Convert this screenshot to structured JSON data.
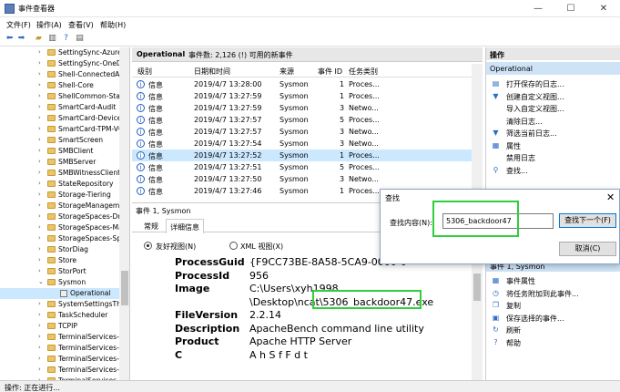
{
  "window": {
    "title": "事件查看器",
    "minimize": "—",
    "maximize": "☐",
    "close": "✕"
  },
  "menu": [
    "文件(F)",
    "操作(A)",
    "查看(V)",
    "帮助(H)"
  ],
  "tree": {
    "items": [
      {
        "label": "SettingSync-Azure",
        "type": "folder"
      },
      {
        "label": "SettingSync-OneDr",
        "type": "folder"
      },
      {
        "label": "Shell-ConnectedAc",
        "type": "folder"
      },
      {
        "label": "Shell-Core",
        "type": "folder"
      },
      {
        "label": "ShellCommon-Stan",
        "type": "folder"
      },
      {
        "label": "SmartCard-Audit",
        "type": "folder"
      },
      {
        "label": "SmartCard-DeviceE",
        "type": "folder"
      },
      {
        "label": "SmartCard-TPM-VC",
        "type": "folder"
      },
      {
        "label": "SmartScreen",
        "type": "folder"
      },
      {
        "label": "SMBClient",
        "type": "folder"
      },
      {
        "label": "SMBServer",
        "type": "folder"
      },
      {
        "label": "SMBWitnessClient",
        "type": "folder"
      },
      {
        "label": "StateRepository",
        "type": "folder"
      },
      {
        "label": "Storage-Tiering",
        "type": "folder"
      },
      {
        "label": "StorageManagemer",
        "type": "folder"
      },
      {
        "label": "StorageSpaces-Driv",
        "type": "folder"
      },
      {
        "label": "StorageSpaces-Mar",
        "type": "folder"
      },
      {
        "label": "StorageSpaces-Spa",
        "type": "folder"
      },
      {
        "label": "StorDiag",
        "type": "folder"
      },
      {
        "label": "Store",
        "type": "folder"
      },
      {
        "label": "StorPort",
        "type": "folder"
      },
      {
        "label": "Sysmon",
        "type": "folder-open"
      },
      {
        "label": "Operational",
        "type": "log"
      },
      {
        "label": "SystemSettingsThre",
        "type": "folder"
      },
      {
        "label": "TaskScheduler",
        "type": "folder"
      },
      {
        "label": "TCPIP",
        "type": "folder"
      },
      {
        "label": "TerminalServices-C",
        "type": "folder"
      },
      {
        "label": "TerminalServices-C",
        "type": "folder"
      },
      {
        "label": "TerminalServices-L",
        "type": "folder"
      },
      {
        "label": "TerminalServices-P",
        "type": "folder"
      },
      {
        "label": "TerminalServices-P",
        "type": "folder"
      }
    ],
    "expand_symbol": "›",
    "collapse_symbol": "⌄"
  },
  "events_panel": {
    "log_name": "Operational",
    "count_text": "事件数: 2,126 (!) 可用的新事件",
    "columns": [
      "级别",
      "日期和时间",
      "来源",
      "事件 ID",
      "任务类别"
    ],
    "rows": [
      {
        "level": "信息",
        "datetime": "2019/4/7 13:28:00",
        "source": "Sysmon",
        "event_id": "1",
        "category": "Proces..."
      },
      {
        "level": "信息",
        "datetime": "2019/4/7 13:27:59",
        "source": "Sysmon",
        "event_id": "1",
        "category": "Proces..."
      },
      {
        "level": "信息",
        "datetime": "2019/4/7 13:27:59",
        "source": "Sysmon",
        "event_id": "3",
        "category": "Netwo..."
      },
      {
        "level": "信息",
        "datetime": "2019/4/7 13:27:57",
        "source": "Sysmon",
        "event_id": "5",
        "category": "Proces..."
      },
      {
        "level": "信息",
        "datetime": "2019/4/7 13:27:57",
        "source": "Sysmon",
        "event_id": "3",
        "category": "Netwo..."
      },
      {
        "level": "信息",
        "datetime": "2019/4/7 13:27:54",
        "source": "Sysmon",
        "event_id": "3",
        "category": "Netwo..."
      },
      {
        "level": "信息",
        "datetime": "2019/4/7 13:27:52",
        "source": "Sysmon",
        "event_id": "1",
        "category": "Proces..."
      },
      {
        "level": "信息",
        "datetime": "2019/4/7 13:27:51",
        "source": "Sysmon",
        "event_id": "5",
        "category": "Proces..."
      },
      {
        "level": "信息",
        "datetime": "2019/4/7 13:27:50",
        "source": "Sysmon",
        "event_id": "3",
        "category": "Netwo..."
      },
      {
        "level": "信息",
        "datetime": "2019/4/7 13:27:46",
        "source": "Sysmon",
        "event_id": "1",
        "category": "Proces..."
      }
    ],
    "selected_index": 6,
    "info_glyph": "i"
  },
  "details": {
    "header": "事件 1, Sysmon",
    "close": "✕",
    "tabs": [
      "常规",
      "详细信息"
    ],
    "active_tab": 1,
    "radio_friendly": "友好视图(N)",
    "radio_xml": "XML 视图(X)",
    "fields": [
      {
        "key": "ProcessGuid",
        "value": "{F9CC73BE-8A58-5CA9-0000-0"
      },
      {
        "key": "ProcessId",
        "value": "956"
      },
      {
        "key": "Image",
        "value": "C:\\Users\\xyh1998"
      },
      {
        "key": "",
        "value": "\\Desktop\\ncat\\5306_backdoor47.exe"
      },
      {
        "key": "FileVersion",
        "value": "2.2.14"
      },
      {
        "key": "Description",
        "value": "ApacheBench command line utility"
      },
      {
        "key": "Product",
        "value": "Apache HTTP Server"
      },
      {
        "key": "C",
        "value": "A   h  S  f  F     d  t"
      }
    ]
  },
  "actions": {
    "title": "操作",
    "section1": "Operational",
    "items1": [
      {
        "icon": "▤",
        "label": "打开保存的日志..."
      },
      {
        "icon": "▼",
        "label": "创建自定义视图..."
      },
      {
        "icon": "",
        "label": "导入自定义视图..."
      },
      {
        "icon": "",
        "label": "清除日志..."
      },
      {
        "icon": "▼",
        "label": "筛选当前日志..."
      },
      {
        "icon": "▦",
        "label": "属性"
      },
      {
        "icon": "",
        "label": "禁用日志"
      },
      {
        "icon": "⚲",
        "label": "查找..."
      }
    ],
    "section2": "事件 1, Sysmon",
    "items2": [
      {
        "icon": "▦",
        "label": "事件属性"
      },
      {
        "icon": "◷",
        "label": "将任务附加到此事件..."
      },
      {
        "icon": "❐",
        "label": "复制"
      },
      {
        "icon": "▣",
        "label": "保存选择的事件..."
      },
      {
        "icon": "↻",
        "label": "刷新"
      },
      {
        "icon": "?",
        "label": "帮助"
      }
    ],
    "more_arrow": "›"
  },
  "find_dialog": {
    "title": "查找",
    "close": "✕",
    "label": "查找内容(N):",
    "value": "5306_backdoor47",
    "find_next": "查找下一个(F)",
    "cancel": "取消(C)"
  },
  "status": "操作: 正在进行..."
}
